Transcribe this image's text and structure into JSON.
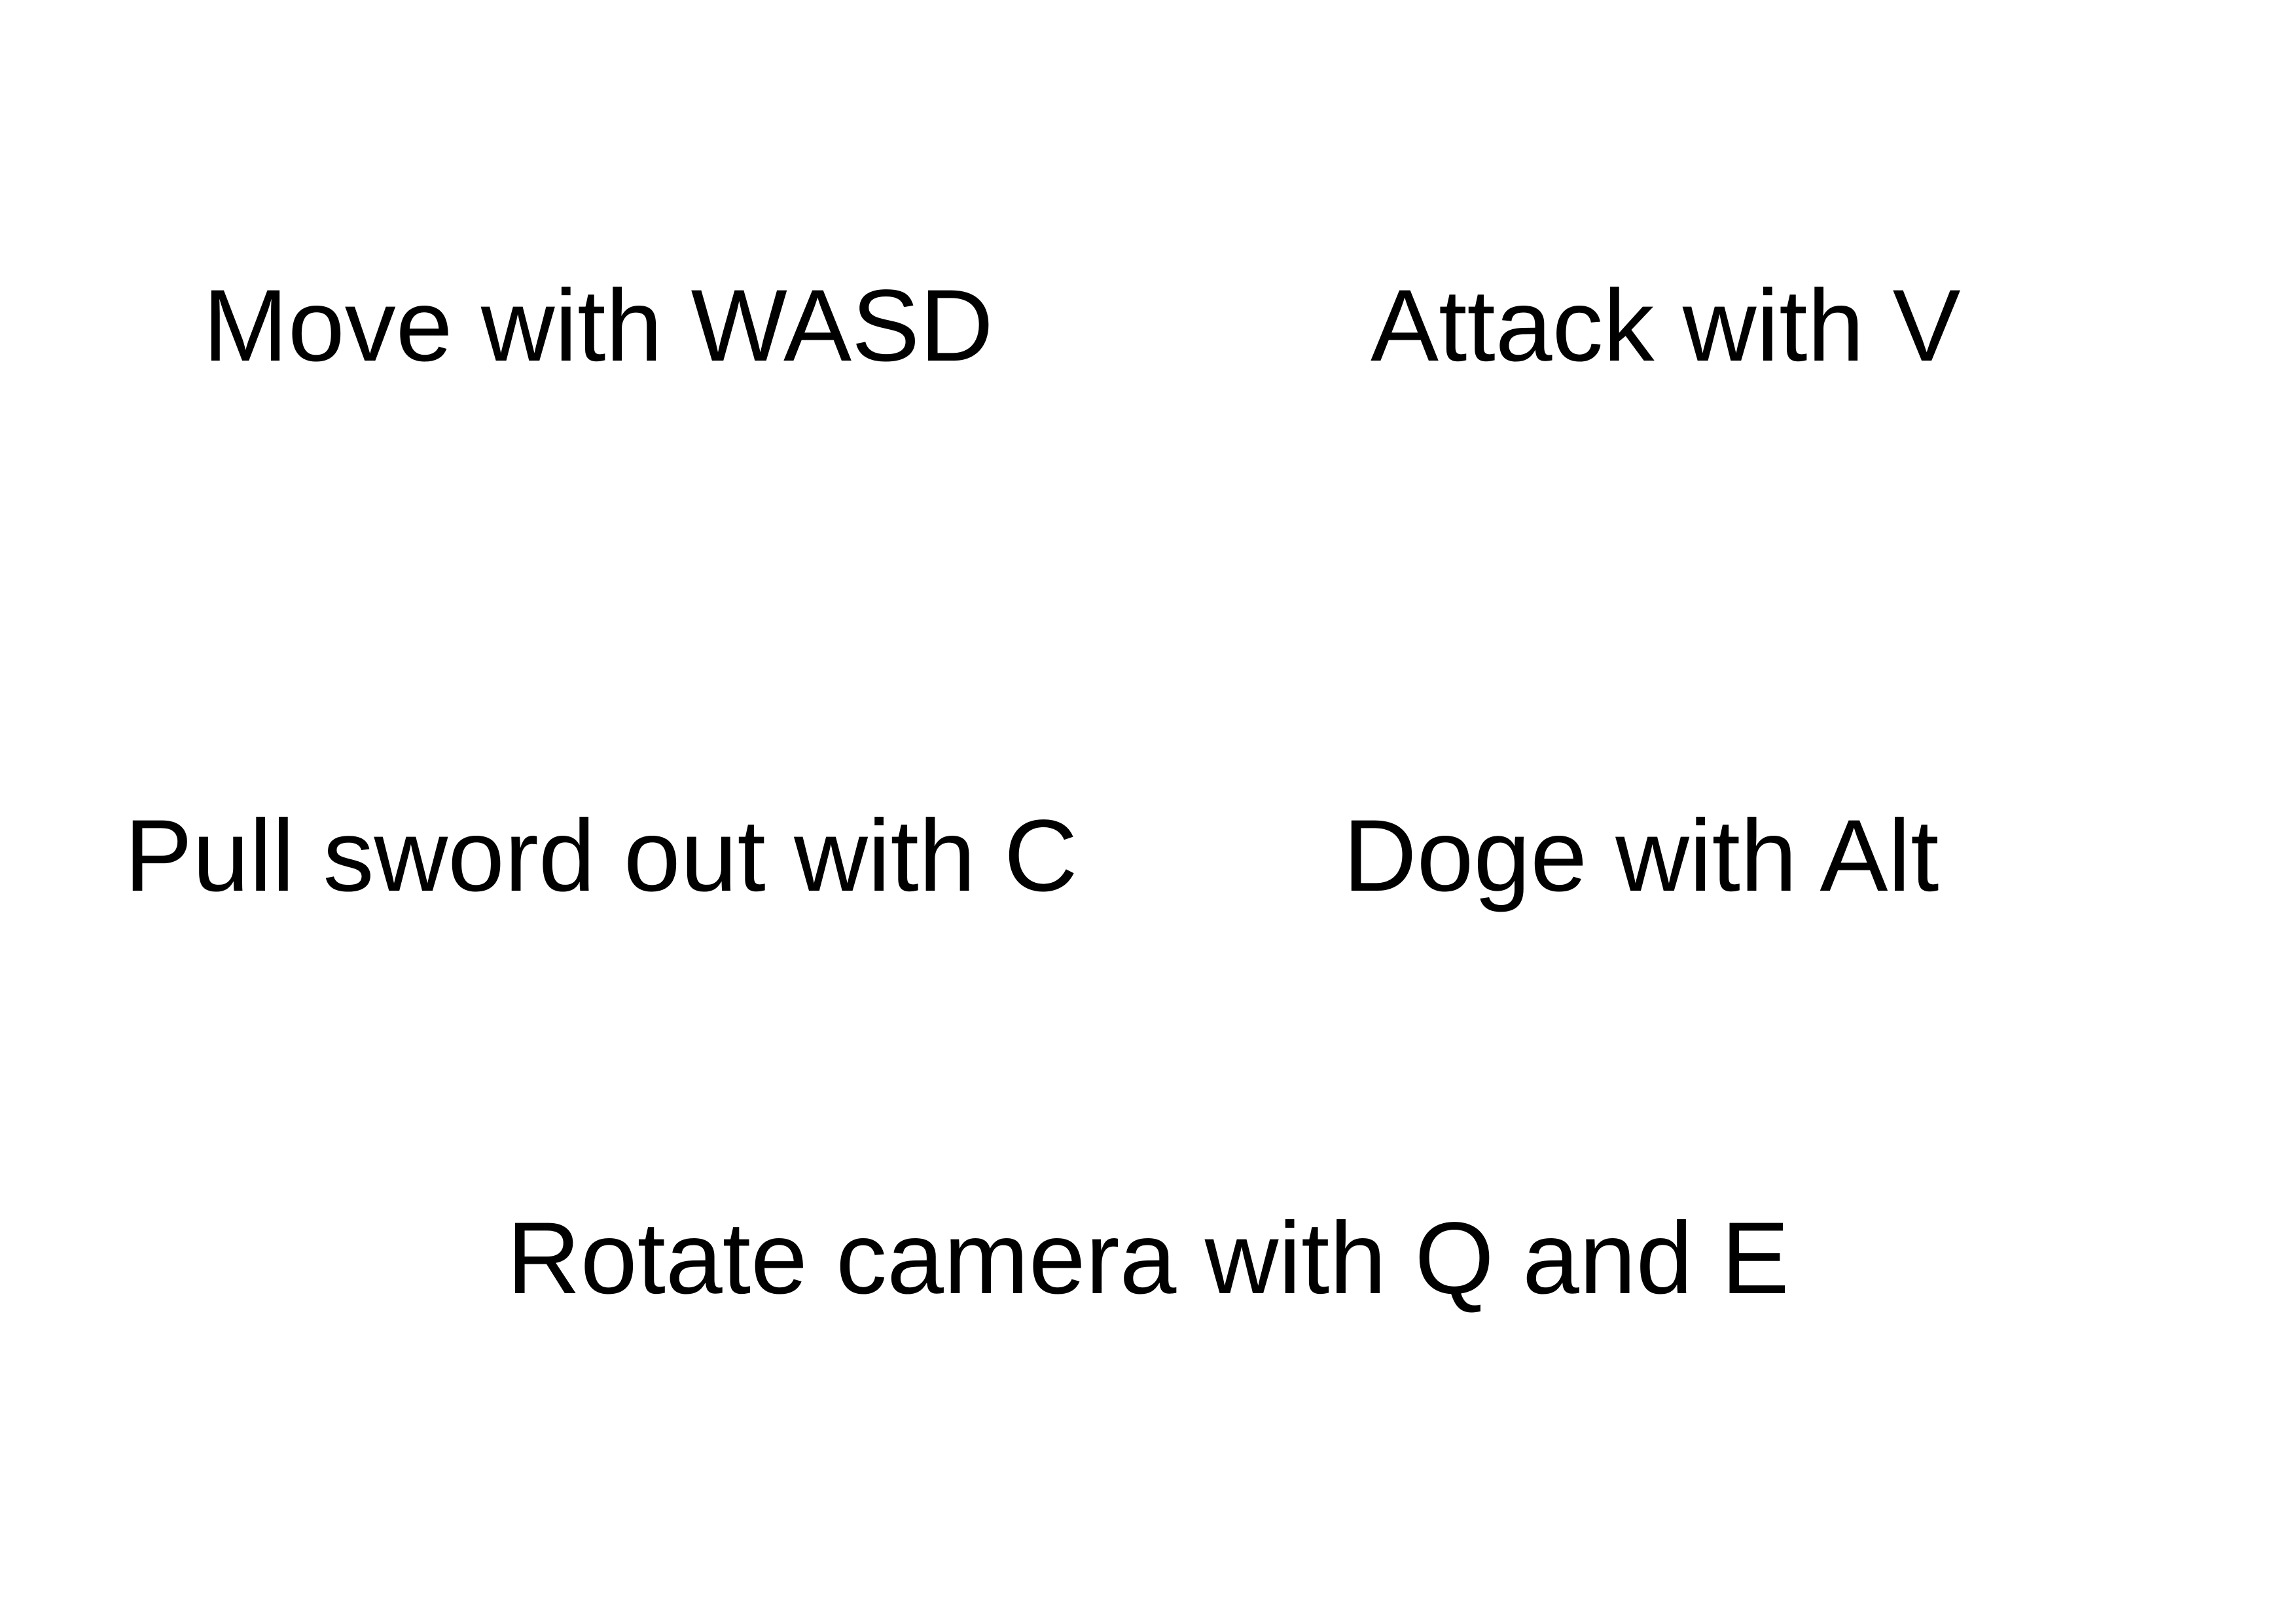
{
  "controls": {
    "move": "Move with WASD",
    "attack": "Attack with V",
    "sword": "Pull sword out with C",
    "dodge": "Doge with Alt",
    "camera": "Rotate camera with Q and E"
  }
}
